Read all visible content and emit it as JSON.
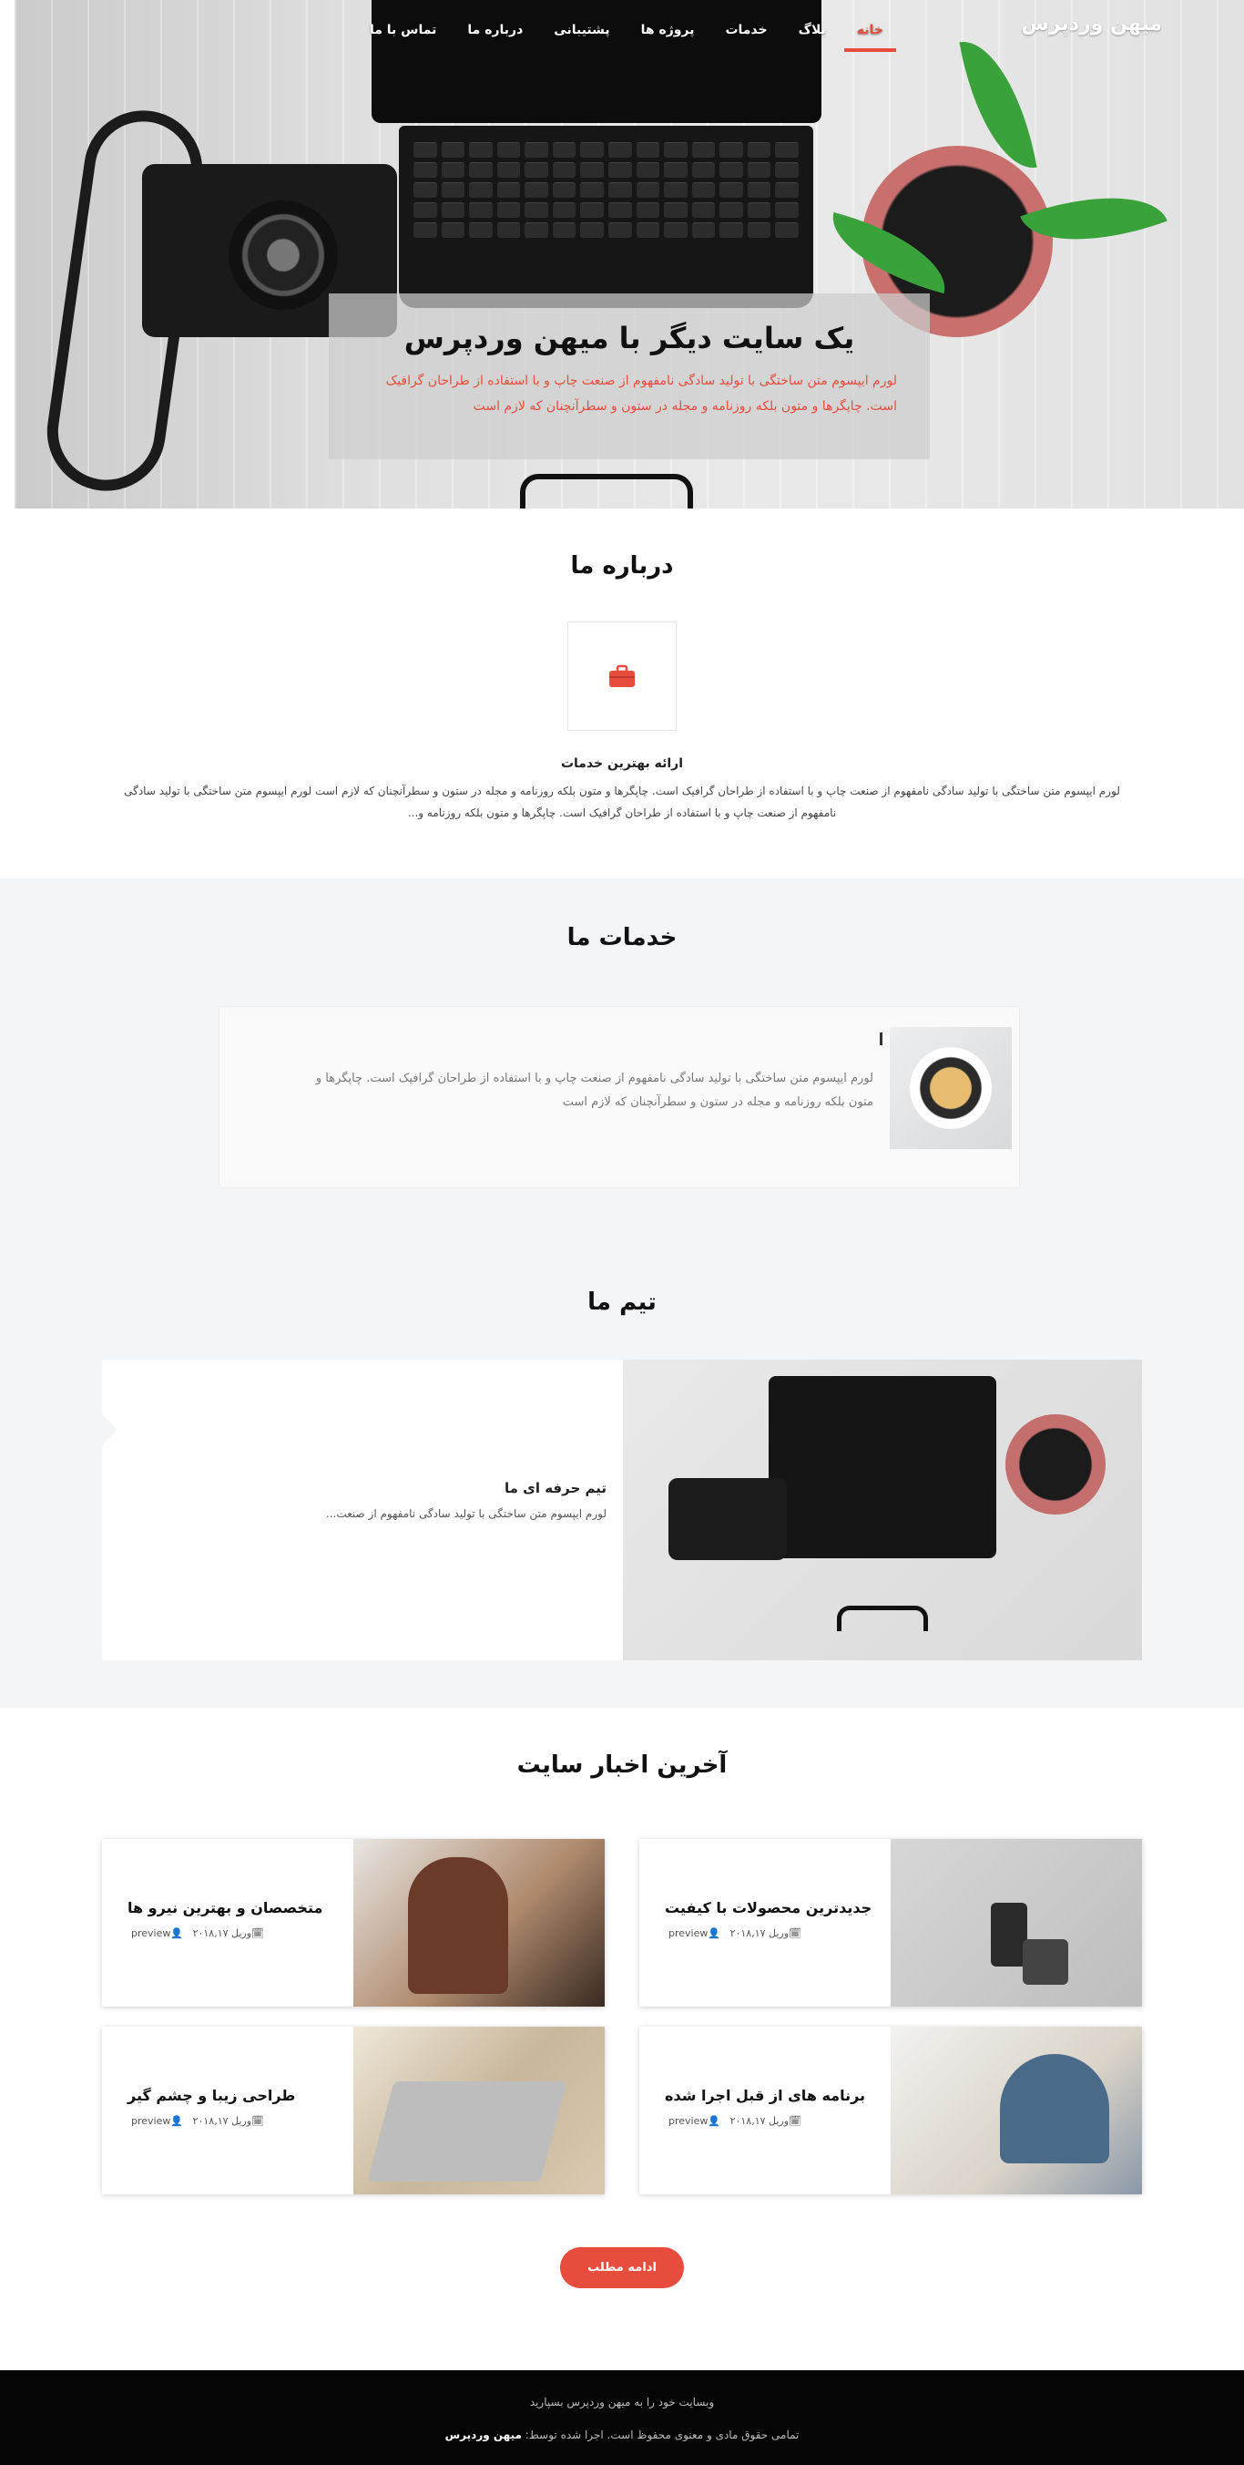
{
  "header": {
    "brand": "میهن وردپرس",
    "nav": [
      "خانه",
      "بلاگ",
      "خدمات",
      "پروژه ها",
      "پشتیبانی",
      "درباره ما",
      "تماس با ما"
    ]
  },
  "hero": {
    "title": "یک سایت دیگر با میهن وردپرس",
    "text": "لورم ایپسوم متن ساختگی با تولید سادگی نامفهوم از صنعت چاپ و با استفاده از طراحان گرافیک است. چاپگرها و متون بلکه روزنامه و مجله در ستون و سطرآنچنان که لازم است"
  },
  "about": {
    "title": "درباره ما",
    "subtitle": "ارائه بهترین خدمات",
    "text": "لورم ایپسوم متن ساختگی با تولید سادگی نامفهوم از صنعت چاپ و با استفاده از طراحان گرافیک است. چاپگرها و متون بلکه روزنامه و مجله در ستون و سطرآنچنان که لازم است لورم ایپسوم متن ساختگی با تولید سادگی نامفهوم از صنعت چاپ و با استفاده از طراحان گرافیک است. چاپگرها و متون بلکه روزنامه و..."
  },
  "services": {
    "title": "خدمات ما",
    "card_text": "لورم ایپسوم متن ساختگی با تولید سادگی نامفهوم از صنعت چاپ و با استفاده از طراحان گرافیک است. چاپگرها و متون بلکه روزنامه و مجله در ستون و سطرآنچنان که لازم است"
  },
  "team": {
    "title": "تیم ما",
    "member_title": "تیم حرفه ای ما",
    "member_desc": "لورم ایپسوم متن ساختگی با تولید سادگی نامفهوم از صنعت..."
  },
  "news": {
    "title": "آخرین اخبار سایت",
    "items": [
      {
        "title": "جدیدترین محصولات با کیفیت",
        "date": "وریل ۲۰۱۸,۱۷",
        "author": "preview"
      },
      {
        "title": "متخصصان و بهترین نیرو ها",
        "date": "وریل ۲۰۱۸,۱۷",
        "author": "preview"
      },
      {
        "title": "برنامه های از قبل اجرا شده",
        "date": "وریل ۲۰۱۸,۱۷",
        "author": "preview"
      },
      {
        "title": "طراحی زیبا و چشم گیر",
        "date": "وریل ۲۰۱۸,۱۷",
        "author": "preview"
      }
    ],
    "more_button": "ادامه مطلب"
  },
  "footer": {
    "line1": "وبسایت خود را به میهن وردپرس بسپارید",
    "line2_prefix": "تمامی حقوق مادی و معنوی محفوظ است. اجرا شده توسط:",
    "line2_brand": "میهن وردپرس"
  },
  "colors": {
    "accent": "#e74c3c",
    "section_bg": "#f4f5f7",
    "footer_bg": "#050505"
  },
  "icons": {
    "about_icon": "briefcase-icon",
    "date_icon": "calendar-icon",
    "author_icon": "user-icon"
  }
}
